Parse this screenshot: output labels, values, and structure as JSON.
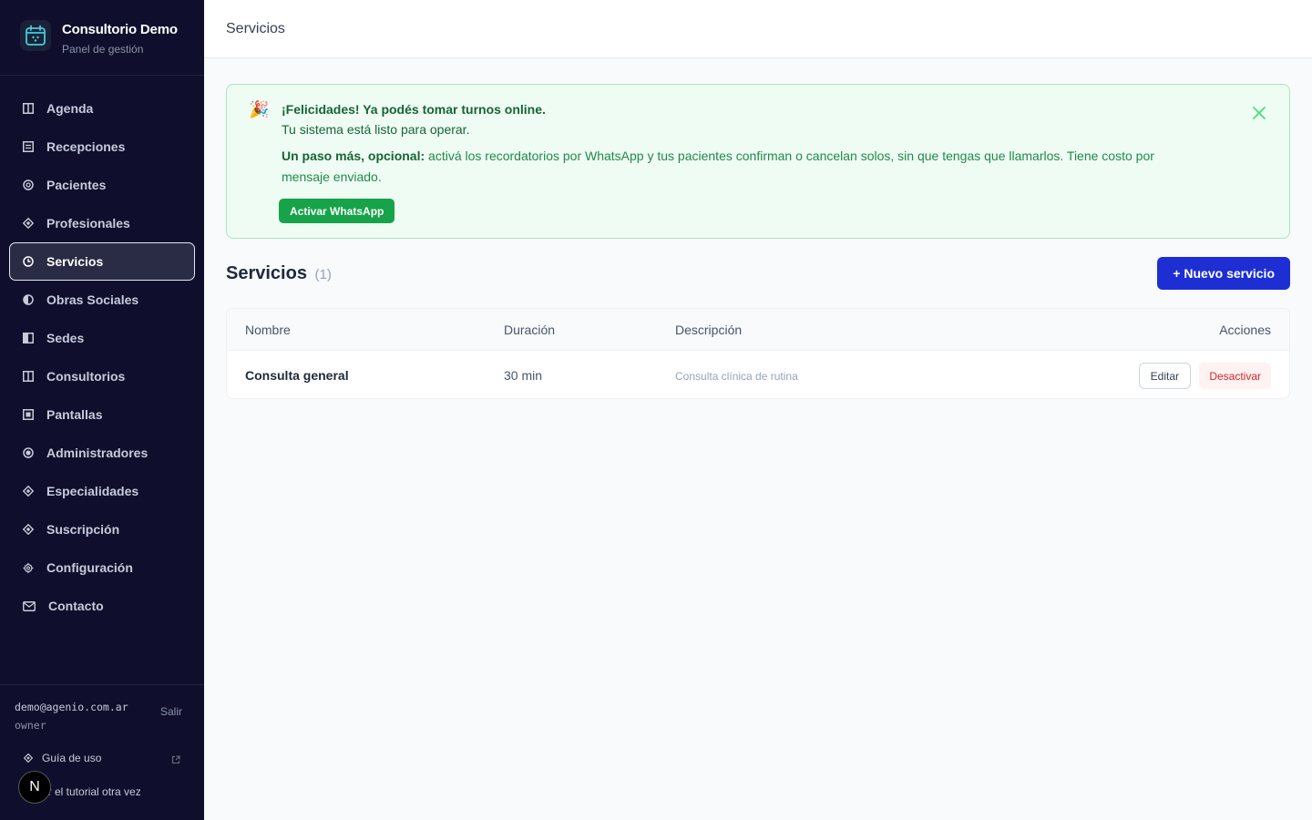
{
  "brand": {
    "title": "Consultorio Demo",
    "subtitle": "Panel de gestión",
    "icon": "calendar-icon"
  },
  "sidebar": {
    "items": [
      {
        "label": "Agenda",
        "icon": "columns-icon",
        "active": false
      },
      {
        "label": "Recepciones",
        "icon": "list-icon",
        "active": false
      },
      {
        "label": "Pacientes",
        "icon": "circle-icon",
        "active": false
      },
      {
        "label": "Profesionales",
        "icon": "diamond-icon",
        "active": false
      },
      {
        "label": "Servicios",
        "icon": "clock-icon",
        "active": true
      },
      {
        "label": "Obras Sociales",
        "icon": "half-circle-icon",
        "active": false
      },
      {
        "label": "Sedes",
        "icon": "half-square-icon",
        "active": false
      },
      {
        "label": "Consultorios",
        "icon": "columns-icon",
        "active": false
      },
      {
        "label": "Pantallas",
        "icon": "square-dot-icon",
        "active": false
      },
      {
        "label": "Administradores",
        "icon": "target-icon",
        "active": false
      },
      {
        "label": "Especialidades",
        "icon": "diamond-icon",
        "active": false
      },
      {
        "label": "Suscripción",
        "icon": "diamond-icon",
        "active": false
      },
      {
        "label": "Configuración",
        "icon": "gear-icon",
        "active": false
      },
      {
        "label": "Contacto",
        "icon": "mail-icon",
        "active": false
      }
    ],
    "footer": {
      "email": "demo@agenio.com.ar",
      "role": "owner",
      "logout": "Salir",
      "guide": "Guía de uso",
      "tutorial": "er el tutorial otra vez",
      "badge": "N"
    }
  },
  "topbar": {
    "title": "Servicios"
  },
  "banner": {
    "emoji": "🎉",
    "title": "¡Felicidades! Ya podés tomar turnos online.",
    "subtitle": "Tu sistema está listo para operar.",
    "body_bold": "Un paso más, opcional:",
    "body": " activá los recordatorios por WhatsApp y tus pacientes confirman o cancelan solos, sin que tengas que llamarlos. Tiene costo por mensaje enviado.",
    "button": "Activar WhatsApp"
  },
  "section": {
    "title": "Servicios",
    "count": "(1)",
    "new_button": "+ Nuevo servicio"
  },
  "table": {
    "columns": [
      "Nombre",
      "Duración",
      "Descripción",
      "Acciones"
    ],
    "rows": [
      {
        "name": "Consulta general",
        "duration": "30 min",
        "description": "Consulta clínica de rutina",
        "edit": "Editar",
        "deactivate": "Desactivar"
      }
    ]
  },
  "colors": {
    "sidebar_bg": "#0f0f2d",
    "primary": "#1d2fd3",
    "success": "#16a34a",
    "danger": "#dc2626"
  }
}
